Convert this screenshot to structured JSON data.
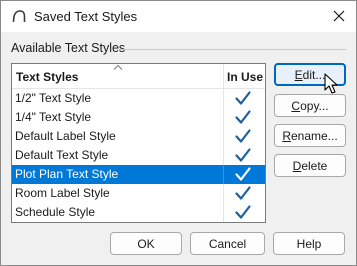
{
  "window": {
    "title": "Saved Text Styles",
    "close_glyph": "✕"
  },
  "group": {
    "label": "Available Text Styles"
  },
  "list": {
    "headers": {
      "name": "Text Styles",
      "in_use": "In Use"
    },
    "sort_indicator": "ascending",
    "rows": [
      {
        "name": "1/2\" Text Style",
        "in_use": true
      },
      {
        "name": "1/4\" Text Style",
        "in_use": true
      },
      {
        "name": "Default Label Style",
        "in_use": true
      },
      {
        "name": "Default Text Style",
        "in_use": true
      },
      {
        "name": "Plot Plan Text Style",
        "in_use": true,
        "selected": true
      },
      {
        "name": "Room Label Style",
        "in_use": true
      },
      {
        "name": "Schedule Style",
        "in_use": true
      }
    ]
  },
  "buttons": {
    "edit": {
      "pre": "",
      "mnemonic": "E",
      "post": "dit..."
    },
    "copy": {
      "pre": "",
      "mnemonic": "C",
      "post": "opy..."
    },
    "rename": {
      "pre": "",
      "mnemonic": "R",
      "post": "ename..."
    },
    "delete": {
      "pre": "",
      "mnemonic": "D",
      "post": "elete"
    },
    "ok": "OK",
    "cancel": "Cancel",
    "help": "Help"
  },
  "colors": {
    "selection": "#0078d7",
    "check": "#1f5f9b",
    "check_selected": "#ffffff",
    "focus_border": "#0067c0"
  },
  "icons": {
    "app": "arc-app-icon",
    "close": "close-icon",
    "check": "checkmark-icon",
    "sort": "sort-ascending-icon",
    "cursor": "mouse-pointer-icon"
  }
}
